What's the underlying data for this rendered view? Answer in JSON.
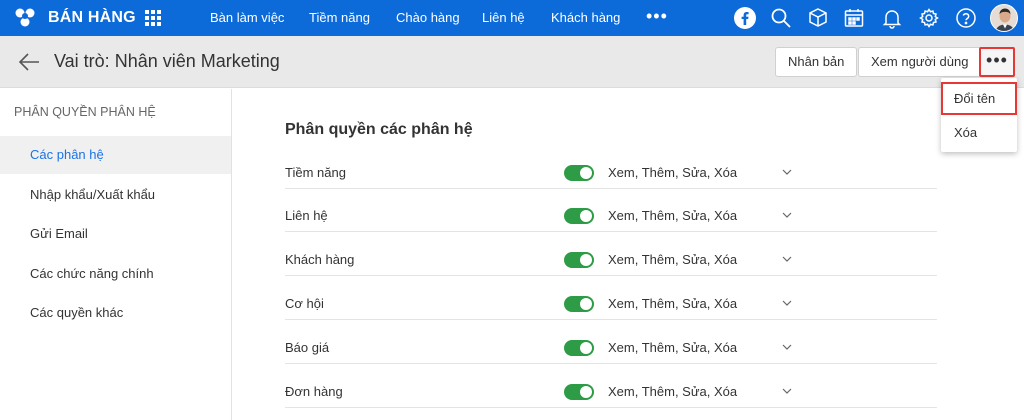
{
  "topbar": {
    "brand": "BÁN HÀNG",
    "nav": [
      "Bàn làm việc",
      "Tiềm năng",
      "Chào hàng",
      "Liên hệ",
      "Khách hàng"
    ],
    "more": "•••",
    "icons": [
      "facebook-icon",
      "search-icon",
      "package-icon",
      "calendar-icon",
      "bell-icon",
      "gear-icon",
      "help-icon"
    ],
    "accent": "#0c6ad9"
  },
  "header": {
    "title": "Vai trò: Nhân viên Marketing",
    "duplicate_label": "Nhân bản",
    "view_users_label": "Xem người dùng",
    "more_label": "•••"
  },
  "sidebar": {
    "title": "PHÂN QUYỀN PHÂN HỆ",
    "items": [
      "Các phân hệ",
      "Nhập khẩu/Xuất khẩu",
      "Gửi Email",
      "Các chức năng chính",
      "Các quyền khác"
    ],
    "active_index": 0
  },
  "main": {
    "section_title": "Phân quyền các phân hệ",
    "rows": [
      {
        "label": "Tiềm năng",
        "enabled": true,
        "value": "Xem, Thêm, Sửa, Xóa"
      },
      {
        "label": "Liên hệ",
        "enabled": true,
        "value": "Xem, Thêm, Sửa, Xóa"
      },
      {
        "label": "Khách hàng",
        "enabled": true,
        "value": "Xem, Thêm, Sửa, Xóa"
      },
      {
        "label": "Cơ hội",
        "enabled": true,
        "value": "Xem, Thêm, Sửa, Xóa"
      },
      {
        "label": "Báo giá",
        "enabled": true,
        "value": "Xem, Thêm, Sửa, Xóa"
      },
      {
        "label": "Đơn hàng",
        "enabled": true,
        "value": "Xem, Thêm, Sửa, Xóa"
      }
    ],
    "toggle_color": "#2e9c46"
  },
  "dropdown": {
    "items": [
      "Đổi tên",
      "Xóa"
    ]
  }
}
